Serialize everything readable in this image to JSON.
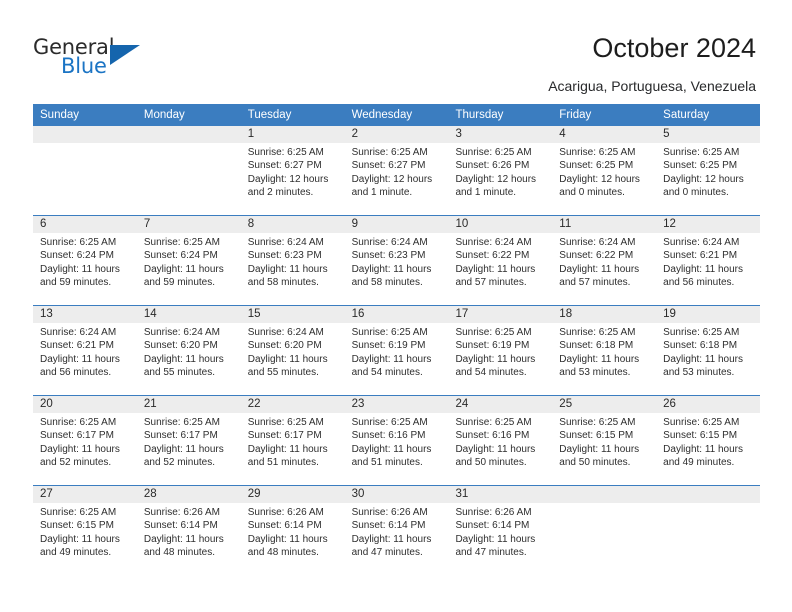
{
  "brand": {
    "name_top": "General",
    "name_bottom": "Blue",
    "accent_color": "#1b74c4",
    "triangle_color": "#1565ad"
  },
  "header": {
    "title": "October 2024",
    "location": "Acarigua, Portuguesa, Venezuela"
  },
  "calendar": {
    "header_bg": "#3b7dc0",
    "daynum_bg": "#ededed",
    "weekdays": [
      "Sunday",
      "Monday",
      "Tuesday",
      "Wednesday",
      "Thursday",
      "Friday",
      "Saturday"
    ],
    "weeks": [
      [
        {
          "day": "",
          "sunrise": "",
          "sunset": "",
          "daylight": "",
          "empty": true
        },
        {
          "day": "",
          "sunrise": "",
          "sunset": "",
          "daylight": "",
          "empty": true
        },
        {
          "day": "1",
          "sunrise": "Sunrise: 6:25 AM",
          "sunset": "Sunset: 6:27 PM",
          "daylight": "Daylight: 12 hours and 2 minutes."
        },
        {
          "day": "2",
          "sunrise": "Sunrise: 6:25 AM",
          "sunset": "Sunset: 6:27 PM",
          "daylight": "Daylight: 12 hours and 1 minute."
        },
        {
          "day": "3",
          "sunrise": "Sunrise: 6:25 AM",
          "sunset": "Sunset: 6:26 PM",
          "daylight": "Daylight: 12 hours and 1 minute."
        },
        {
          "day": "4",
          "sunrise": "Sunrise: 6:25 AM",
          "sunset": "Sunset: 6:25 PM",
          "daylight": "Daylight: 12 hours and 0 minutes."
        },
        {
          "day": "5",
          "sunrise": "Sunrise: 6:25 AM",
          "sunset": "Sunset: 6:25 PM",
          "daylight": "Daylight: 12 hours and 0 minutes."
        }
      ],
      [
        {
          "day": "6",
          "sunrise": "Sunrise: 6:25 AM",
          "sunset": "Sunset: 6:24 PM",
          "daylight": "Daylight: 11 hours and 59 minutes."
        },
        {
          "day": "7",
          "sunrise": "Sunrise: 6:25 AM",
          "sunset": "Sunset: 6:24 PM",
          "daylight": "Daylight: 11 hours and 59 minutes."
        },
        {
          "day": "8",
          "sunrise": "Sunrise: 6:24 AM",
          "sunset": "Sunset: 6:23 PM",
          "daylight": "Daylight: 11 hours and 58 minutes."
        },
        {
          "day": "9",
          "sunrise": "Sunrise: 6:24 AM",
          "sunset": "Sunset: 6:23 PM",
          "daylight": "Daylight: 11 hours and 58 minutes."
        },
        {
          "day": "10",
          "sunrise": "Sunrise: 6:24 AM",
          "sunset": "Sunset: 6:22 PM",
          "daylight": "Daylight: 11 hours and 57 minutes."
        },
        {
          "day": "11",
          "sunrise": "Sunrise: 6:24 AM",
          "sunset": "Sunset: 6:22 PM",
          "daylight": "Daylight: 11 hours and 57 minutes."
        },
        {
          "day": "12",
          "sunrise": "Sunrise: 6:24 AM",
          "sunset": "Sunset: 6:21 PM",
          "daylight": "Daylight: 11 hours and 56 minutes."
        }
      ],
      [
        {
          "day": "13",
          "sunrise": "Sunrise: 6:24 AM",
          "sunset": "Sunset: 6:21 PM",
          "daylight": "Daylight: 11 hours and 56 minutes."
        },
        {
          "day": "14",
          "sunrise": "Sunrise: 6:24 AM",
          "sunset": "Sunset: 6:20 PM",
          "daylight": "Daylight: 11 hours and 55 minutes."
        },
        {
          "day": "15",
          "sunrise": "Sunrise: 6:24 AM",
          "sunset": "Sunset: 6:20 PM",
          "daylight": "Daylight: 11 hours and 55 minutes."
        },
        {
          "day": "16",
          "sunrise": "Sunrise: 6:25 AM",
          "sunset": "Sunset: 6:19 PM",
          "daylight": "Daylight: 11 hours and 54 minutes."
        },
        {
          "day": "17",
          "sunrise": "Sunrise: 6:25 AM",
          "sunset": "Sunset: 6:19 PM",
          "daylight": "Daylight: 11 hours and 54 minutes."
        },
        {
          "day": "18",
          "sunrise": "Sunrise: 6:25 AM",
          "sunset": "Sunset: 6:18 PM",
          "daylight": "Daylight: 11 hours and 53 minutes."
        },
        {
          "day": "19",
          "sunrise": "Sunrise: 6:25 AM",
          "sunset": "Sunset: 6:18 PM",
          "daylight": "Daylight: 11 hours and 53 minutes."
        }
      ],
      [
        {
          "day": "20",
          "sunrise": "Sunrise: 6:25 AM",
          "sunset": "Sunset: 6:17 PM",
          "daylight": "Daylight: 11 hours and 52 minutes."
        },
        {
          "day": "21",
          "sunrise": "Sunrise: 6:25 AM",
          "sunset": "Sunset: 6:17 PM",
          "daylight": "Daylight: 11 hours and 52 minutes."
        },
        {
          "day": "22",
          "sunrise": "Sunrise: 6:25 AM",
          "sunset": "Sunset: 6:17 PM",
          "daylight": "Daylight: 11 hours and 51 minutes."
        },
        {
          "day": "23",
          "sunrise": "Sunrise: 6:25 AM",
          "sunset": "Sunset: 6:16 PM",
          "daylight": "Daylight: 11 hours and 51 minutes."
        },
        {
          "day": "24",
          "sunrise": "Sunrise: 6:25 AM",
          "sunset": "Sunset: 6:16 PM",
          "daylight": "Daylight: 11 hours and 50 minutes."
        },
        {
          "day": "25",
          "sunrise": "Sunrise: 6:25 AM",
          "sunset": "Sunset: 6:15 PM",
          "daylight": "Daylight: 11 hours and 50 minutes."
        },
        {
          "day": "26",
          "sunrise": "Sunrise: 6:25 AM",
          "sunset": "Sunset: 6:15 PM",
          "daylight": "Daylight: 11 hours and 49 minutes."
        }
      ],
      [
        {
          "day": "27",
          "sunrise": "Sunrise: 6:25 AM",
          "sunset": "Sunset: 6:15 PM",
          "daylight": "Daylight: 11 hours and 49 minutes."
        },
        {
          "day": "28",
          "sunrise": "Sunrise: 6:26 AM",
          "sunset": "Sunset: 6:14 PM",
          "daylight": "Daylight: 11 hours and 48 minutes."
        },
        {
          "day": "29",
          "sunrise": "Sunrise: 6:26 AM",
          "sunset": "Sunset: 6:14 PM",
          "daylight": "Daylight: 11 hours and 48 minutes."
        },
        {
          "day": "30",
          "sunrise": "Sunrise: 6:26 AM",
          "sunset": "Sunset: 6:14 PM",
          "daylight": "Daylight: 11 hours and 47 minutes."
        },
        {
          "day": "31",
          "sunrise": "Sunrise: 6:26 AM",
          "sunset": "Sunset: 6:14 PM",
          "daylight": "Daylight: 11 hours and 47 minutes."
        },
        {
          "day": "",
          "sunrise": "",
          "sunset": "",
          "daylight": "",
          "empty": true
        },
        {
          "day": "",
          "sunrise": "",
          "sunset": "",
          "daylight": "",
          "empty": true
        }
      ]
    ]
  }
}
